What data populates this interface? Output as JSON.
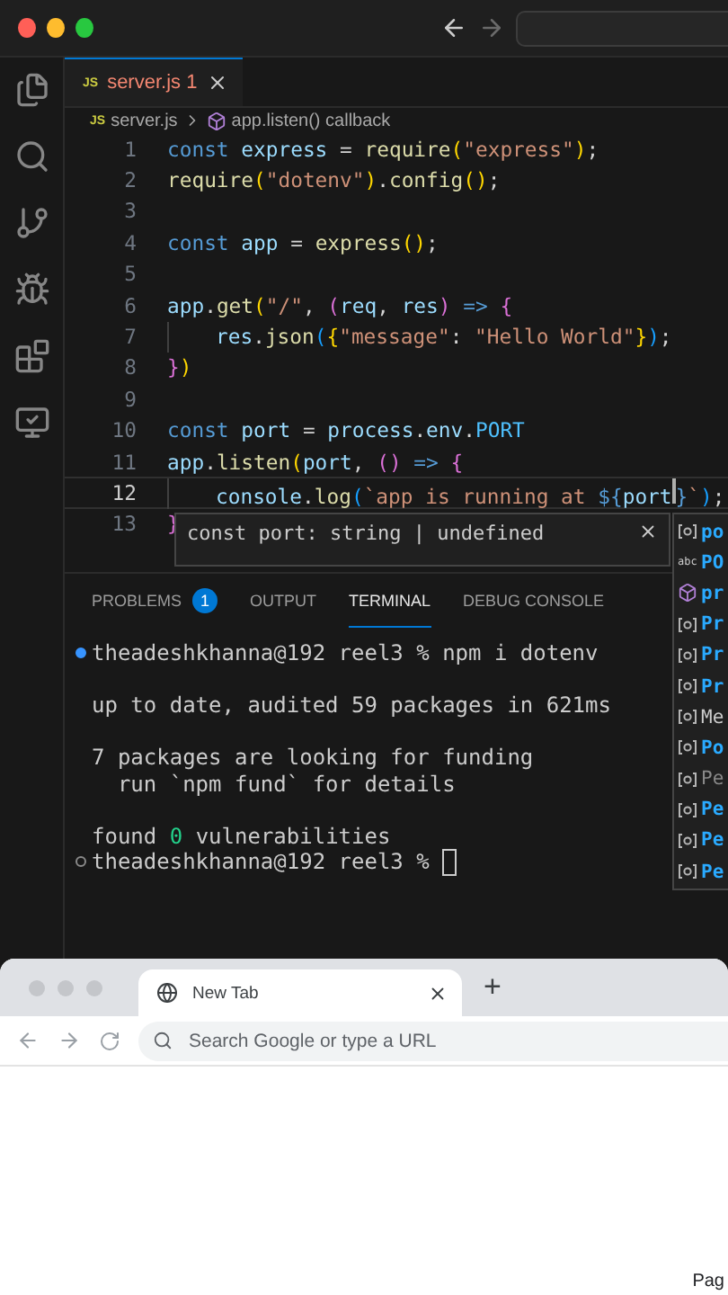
{
  "editor_tabs": [
    {
      "icon_label": "JS",
      "label": "server.js",
      "badge": "1",
      "has_error": true,
      "selected": true
    }
  ],
  "breadcrumb": {
    "icon_label": "JS",
    "file": "server.js",
    "symbol": "app.listen() callback"
  },
  "code_lines": [
    {
      "number": "1",
      "current": false,
      "indented": false,
      "tokens": [
        {
          "text": "const",
          "kind": "keyword"
        },
        {
          "text": " express",
          "kind": "variable"
        },
        {
          "text": " = ",
          "kind": "plain"
        },
        {
          "text": "require",
          "kind": "function"
        },
        {
          "text": "(",
          "kind": "bracket"
        },
        {
          "text": "\"express\"",
          "kind": "string"
        },
        {
          "text": ")",
          "kind": "bracket"
        },
        {
          "text": ";",
          "kind": "plain"
        }
      ]
    },
    {
      "number": "2",
      "current": false,
      "indented": false,
      "tokens": [
        {
          "text": "require",
          "kind": "function"
        },
        {
          "text": "(",
          "kind": "bracket"
        },
        {
          "text": "\"dotenv\"",
          "kind": "string"
        },
        {
          "text": ")",
          "kind": "bracket"
        },
        {
          "text": ".",
          "kind": "plain"
        },
        {
          "text": "config",
          "kind": "function"
        },
        {
          "text": "()",
          "kind": "bracket"
        },
        {
          "text": ";",
          "kind": "plain"
        }
      ]
    },
    {
      "number": "3",
      "current": false,
      "indented": false
    },
    {
      "number": "4",
      "current": false,
      "indented": false,
      "tokens": [
        {
          "text": "const",
          "kind": "keyword"
        },
        {
          "text": " app",
          "kind": "variable"
        },
        {
          "text": " = ",
          "kind": "plain"
        },
        {
          "text": "express",
          "kind": "function"
        },
        {
          "text": "()",
          "kind": "bracket"
        },
        {
          "text": ";",
          "kind": "plain"
        }
      ]
    },
    {
      "number": "5",
      "current": false,
      "indented": false
    },
    {
      "number": "6",
      "current": false,
      "indented": false,
      "tokens": [
        {
          "text": "app",
          "kind": "variable"
        },
        {
          "text": ".",
          "kind": "plain"
        },
        {
          "text": "get",
          "kind": "function"
        },
        {
          "text": "(",
          "kind": "bracket"
        },
        {
          "text": "\"/\"",
          "kind": "string"
        },
        {
          "text": ", ",
          "kind": "plain"
        },
        {
          "text": "(",
          "kind": "bracket2"
        },
        {
          "text": "req",
          "kind": "variable"
        },
        {
          "text": ", ",
          "kind": "plain"
        },
        {
          "text": "res",
          "kind": "variable"
        },
        {
          "text": ")",
          "kind": "bracket2"
        },
        {
          "text": " => ",
          "kind": "keyword"
        },
        {
          "text": "{",
          "kind": "bracket2"
        }
      ]
    },
    {
      "number": "7",
      "current": false,
      "indented": true,
      "tokens": [
        {
          "text": "res",
          "kind": "variable"
        },
        {
          "text": ".",
          "kind": "plain"
        },
        {
          "text": "json",
          "kind": "function"
        },
        {
          "text": "(",
          "kind": "bracket3"
        },
        {
          "text": "{",
          "kind": "bracket"
        },
        {
          "text": "\"message\"",
          "kind": "string"
        },
        {
          "text": ": ",
          "kind": "plain"
        },
        {
          "text": "\"Hello World\"",
          "kind": "string"
        },
        {
          "text": "}",
          "kind": "bracket"
        },
        {
          "text": ")",
          "kind": "bracket3"
        },
        {
          "text": ";",
          "kind": "plain"
        }
      ]
    },
    {
      "number": "8",
      "current": false,
      "indented": false,
      "tokens": [
        {
          "text": "}",
          "kind": "bracket2"
        },
        {
          "text": ")",
          "kind": "bracket"
        }
      ]
    },
    {
      "number": "9",
      "current": false,
      "indented": false
    },
    {
      "number": "10",
      "current": false,
      "indented": false,
      "tokens": [
        {
          "text": "const",
          "kind": "keyword"
        },
        {
          "text": " port",
          "kind": "variable"
        },
        {
          "text": " = ",
          "kind": "plain"
        },
        {
          "text": "process",
          "kind": "variable"
        },
        {
          "text": ".",
          "kind": "plain"
        },
        {
          "text": "env",
          "kind": "variable"
        },
        {
          "text": ".",
          "kind": "plain"
        },
        {
          "text": "PORT",
          "kind": "constant"
        }
      ]
    },
    {
      "number": "11",
      "current": false,
      "indented": false,
      "tokens": [
        {
          "text": "app",
          "kind": "variable"
        },
        {
          "text": ".",
          "kind": "plain"
        },
        {
          "text": "listen",
          "kind": "function"
        },
        {
          "text": "(",
          "kind": "bracket"
        },
        {
          "text": "port",
          "kind": "variable"
        },
        {
          "text": ", ",
          "kind": "plain"
        },
        {
          "text": "()",
          "kind": "bracket2"
        },
        {
          "text": " => ",
          "kind": "keyword"
        },
        {
          "text": "{",
          "kind": "bracket2"
        }
      ]
    },
    {
      "number": "12",
      "current": true,
      "indented": true,
      "tokens": [
        {
          "text": "console",
          "kind": "variable"
        },
        {
          "text": ".",
          "kind": "plain"
        },
        {
          "text": "log",
          "kind": "function"
        },
        {
          "text": "(",
          "kind": "bracket3"
        },
        {
          "text": "`app is running at ",
          "kind": "string"
        },
        {
          "text": "${",
          "kind": "keyword"
        },
        {
          "text": "port",
          "kind": "variable",
          "caret": true
        },
        {
          "text": "}",
          "kind": "keyword"
        },
        {
          "text": "`",
          "kind": "string"
        },
        {
          "text": ")",
          "kind": "bracket3"
        },
        {
          "text": ";",
          "kind": "plain"
        }
      ]
    },
    {
      "number": "13",
      "current": false,
      "indented": false,
      "tokens": [
        {
          "text": "}",
          "kind": "bracket2"
        }
      ]
    }
  ],
  "hover_tooltip": {
    "text": "const port: string | undefined"
  },
  "suggestions": [
    {
      "kind": "variable",
      "label": "po",
      "matched": true,
      "dimmed": false
    },
    {
      "kind": "text",
      "icon_label": "abc",
      "label": "PO",
      "matched": true,
      "dimmed": false
    },
    {
      "kind": "module",
      "label": "pr",
      "matched": true,
      "dimmed": false
    },
    {
      "kind": "variable",
      "label": "Pr",
      "matched": true,
      "dimmed": false
    },
    {
      "kind": "variable",
      "label": "Pr",
      "matched": true,
      "dimmed": false
    },
    {
      "kind": "variable",
      "label": "Pr",
      "matched": true,
      "dimmed": false
    },
    {
      "kind": "variable",
      "label": "Me",
      "matched": false,
      "dimmed": false
    },
    {
      "kind": "variable",
      "label": "Po",
      "matched": true,
      "dimmed": false
    },
    {
      "kind": "variable",
      "label": "Pe",
      "matched": false,
      "dimmed": true
    },
    {
      "kind": "variable",
      "label": "Pe",
      "matched": true,
      "dimmed": false
    },
    {
      "kind": "variable",
      "label": "Pe",
      "matched": true,
      "dimmed": false
    },
    {
      "kind": "variable",
      "label": "Pe",
      "matched": true,
      "dimmed": false
    }
  ],
  "panel_tabs": [
    {
      "label": "PROBLEMS",
      "badge": "1",
      "selected": false
    },
    {
      "label": "OUTPUT",
      "selected": false
    },
    {
      "label": "TERMINAL",
      "selected": true
    },
    {
      "label": "DEBUG CONSOLE",
      "selected": false
    }
  ],
  "terminal_lines": [
    {
      "kind": "prompt",
      "finished": true,
      "cursor": false,
      "parts": [
        {
          "text": "theadeshkhanna@192 reel3 % npm i dotenv",
          "kind": "plain"
        }
      ]
    },
    {
      "kind": "output"
    },
    {
      "kind": "output",
      "parts": [
        {
          "text": "up to date, audited 59 packages in 621ms",
          "kind": "plain"
        }
      ]
    },
    {
      "kind": "output"
    },
    {
      "kind": "output",
      "parts": [
        {
          "text": "7 packages are looking for funding",
          "kind": "plain"
        }
      ]
    },
    {
      "kind": "output",
      "parts": [
        {
          "text": "  run `npm fund` for details",
          "kind": "plain"
        }
      ]
    },
    {
      "kind": "output"
    },
    {
      "kind": "output",
      "parts": [
        {
          "text": "found ",
          "kind": "plain"
        },
        {
          "text": "0",
          "kind": "success"
        },
        {
          "text": " vulnerabilities",
          "kind": "plain"
        }
      ]
    },
    {
      "kind": "prompt",
      "finished": false,
      "cursor": true,
      "parts": [
        {
          "text": "theadeshkhanna@192 reel3 %",
          "kind": "plain"
        }
      ]
    }
  ],
  "browser": {
    "tab": {
      "title": "New Tab",
      "selected": true
    },
    "new_tab": "+",
    "address_bar": {
      "placeholder": "Search Google or type a URL"
    },
    "page_text": "Pag"
  }
}
